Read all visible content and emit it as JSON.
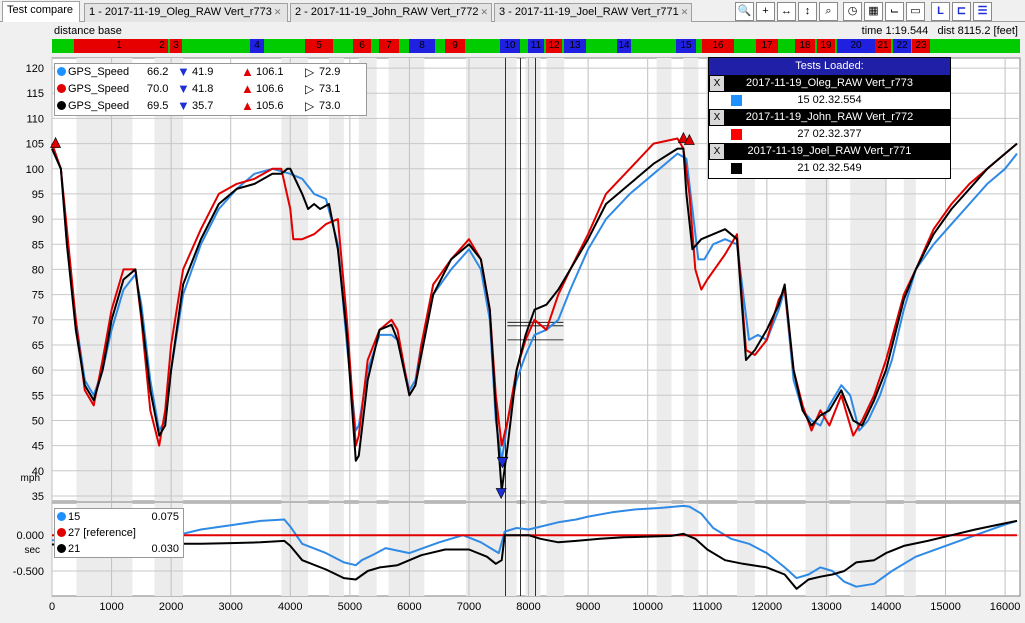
{
  "tabs": [
    {
      "label": "Test compare"
    },
    {
      "label": "1 - 2017-11-19_Oleg_RAW Vert_r773"
    },
    {
      "label": "2 - 2017-11-19_John_RAW Vert_r772"
    },
    {
      "label": "3 - 2017-11-19_Joel_RAW Vert_r771"
    }
  ],
  "toolbar": [
    "zoom-2d-icon",
    "zoom-in-icon",
    "zoom-x-icon",
    "zoom-y-icon",
    "zoom-reset-icon",
    "clock-icon",
    "grid-icon",
    "shoe-icon",
    "lap-icon",
    "l-axis-icon",
    "overlay-icon",
    "list-icon"
  ],
  "info": {
    "base": "distance base",
    "time": "time 1:19.544",
    "dist": "dist 8115.2 [feet]"
  },
  "segments": [
    {
      "label": "1",
      "color": "red"
    },
    {
      "label": "2",
      "color": "red"
    },
    {
      "label": "3",
      "color": "red"
    },
    {
      "label": "4",
      "color": "blue"
    },
    {
      "label": "5",
      "color": "red"
    },
    {
      "label": "6",
      "color": "red"
    },
    {
      "label": "7",
      "color": "red"
    },
    {
      "label": "8",
      "color": "blue"
    },
    {
      "label": "9",
      "color": "red"
    },
    {
      "label": "10",
      "color": "blue"
    },
    {
      "label": "11",
      "color": "blue"
    },
    {
      "label": "12",
      "color": "red"
    },
    {
      "label": "13",
      "color": "blue"
    },
    {
      "label": "14",
      "color": "blue"
    },
    {
      "label": "15",
      "color": "blue"
    },
    {
      "label": "16",
      "color": "red"
    },
    {
      "label": "17",
      "color": "red"
    },
    {
      "label": "18",
      "color": "red"
    },
    {
      "label": "19",
      "color": "red"
    },
    {
      "label": "20",
      "color": "blue"
    },
    {
      "label": "21",
      "color": "red"
    },
    {
      "label": "22",
      "color": "blue"
    },
    {
      "label": "23",
      "color": "red"
    }
  ],
  "speed_legend": [
    {
      "name": "GPS_Speed",
      "color": "#1e90ff",
      "current": "66.2",
      "min": "41.9",
      "max": "106.1",
      "avg": "72.9"
    },
    {
      "name": "GPS_Speed",
      "color": "#e00000",
      "current": "70.0",
      "min": "41.8",
      "max": "106.6",
      "avg": "73.1"
    },
    {
      "name": "GPS_Speed",
      "color": "#000000",
      "current": "69.5",
      "min": "35.7",
      "max": "105.6",
      "avg": "73.0"
    }
  ],
  "tests": {
    "title": "Tests Loaded:",
    "items": [
      {
        "name": "2017-11-19_Oleg_RAW Vert_r773",
        "lap": "15 02.32.554",
        "color": "#1e90ff"
      },
      {
        "name": "2017-11-19_John_RAW Vert_r772",
        "lap": "27 02.32.377",
        "color": "#ff0000"
      },
      {
        "name": "2017-11-19_Joel_RAW Vert_r771",
        "lap": "21 02.32.549",
        "color": "#000000"
      }
    ]
  },
  "delta_legend": [
    {
      "lap": "15",
      "value": "0.075",
      "color": "#1e90ff"
    },
    {
      "lap": "27 [reference]",
      "value": "",
      "color": "#e00000"
    },
    {
      "lap": "21",
      "value": "0.030",
      "color": "#000000"
    }
  ],
  "chart_data": [
    {
      "type": "line",
      "ylabel": "mph",
      "ylim": [
        34,
        122
      ],
      "xlim": [
        0,
        16250
      ],
      "yticks": [
        35,
        40,
        45,
        50,
        55,
        60,
        65,
        70,
        75,
        80,
        85,
        90,
        95,
        100,
        105,
        110,
        115,
        120
      ],
      "grid": true,
      "series": [
        {
          "color": "#2f8ae6",
          "x": [
            0,
            150,
            250,
            400,
            550,
            700,
            850,
            1000,
            1200,
            1400,
            1500,
            1650,
            1800,
            1900,
            2000,
            2200,
            2500,
            2800,
            3100,
            3400,
            3700,
            4000,
            4200,
            4400,
            4600,
            4800,
            4950,
            5100,
            5150,
            5300,
            5500,
            5700,
            5800,
            6000,
            6100,
            6200,
            6400,
            6700,
            7000,
            7200,
            7350,
            7450,
            7550,
            7650,
            7800,
            7950,
            8100,
            8300,
            8500,
            8700,
            9000,
            9300,
            9700,
            10100,
            10500,
            10650,
            10750,
            10850,
            10950,
            11100,
            11300,
            11500,
            11700,
            11850,
            12000,
            12200,
            12300,
            12450,
            12600,
            12750,
            12900,
            13050,
            13250,
            13400,
            13550,
            13700,
            13900,
            14100,
            14300,
            14500,
            14800,
            15100,
            15400,
            15700,
            16000,
            16200
          ],
          "y": [
            104,
            100,
            85,
            70,
            58,
            55,
            60,
            68,
            76,
            79,
            73,
            58,
            48,
            50,
            60,
            75,
            85,
            92,
            96,
            99,
            100,
            99,
            98,
            95,
            94,
            85,
            65,
            48,
            49,
            60,
            67,
            67,
            66,
            56,
            58,
            65,
            75,
            80,
            84,
            80,
            70,
            50,
            42,
            50,
            58,
            63,
            67,
            68,
            70,
            76,
            84,
            90,
            95,
            99,
            103,
            102,
            92,
            82,
            82,
            85,
            86,
            85,
            66,
            67,
            66,
            72,
            76,
            58,
            52,
            50,
            49,
            53,
            57,
            55,
            48,
            50,
            55,
            62,
            72,
            80,
            85,
            89,
            93,
            97,
            100,
            103
          ]
        },
        {
          "color": "#e00000",
          "x": [
            0,
            150,
            250,
            400,
            550,
            700,
            850,
            1000,
            1200,
            1400,
            1500,
            1650,
            1800,
            1900,
            2000,
            2200,
            2500,
            2800,
            3100,
            3400,
            3700,
            3850,
            4000,
            4050,
            4200,
            4400,
            4600,
            4800,
            4950,
            5100,
            5150,
            5300,
            5500,
            5700,
            5800,
            6000,
            6100,
            6200,
            6400,
            6700,
            7000,
            7200,
            7350,
            7450,
            7550,
            7650,
            7800,
            7950,
            8100,
            8300,
            8500,
            8700,
            9000,
            9300,
            9700,
            10100,
            10500,
            10600,
            10700,
            10800,
            10900,
            11000,
            11300,
            11500,
            11650,
            11800,
            12000,
            12200,
            12300,
            12450,
            12600,
            12750,
            12900,
            13050,
            13250,
            13450,
            13600,
            13800,
            14000,
            14300,
            14500,
            14800,
            15100,
            15400,
            15700,
            16000,
            16200
          ],
          "y": [
            105,
            100,
            88,
            70,
            56,
            53,
            62,
            72,
            80,
            80,
            70,
            52,
            45,
            52,
            65,
            80,
            88,
            95,
            97,
            98,
            100,
            100,
            92,
            86,
            86,
            87,
            89,
            90,
            70,
            45,
            47,
            62,
            68,
            70,
            68,
            55,
            57,
            65,
            77,
            82,
            86,
            82,
            72,
            55,
            45,
            50,
            60,
            66,
            70,
            68,
            75,
            80,
            87,
            95,
            100,
            105,
            106,
            104,
            95,
            80,
            76,
            78,
            83,
            87,
            64,
            63,
            66,
            74,
            76,
            60,
            53,
            48,
            52,
            49,
            55,
            47,
            50,
            55,
            62,
            75,
            80,
            88,
            93,
            97,
            100,
            103,
            105
          ]
        },
        {
          "color": "#000000",
          "x": [
            0,
            150,
            250,
            400,
            550,
            700,
            850,
            1000,
            1200,
            1400,
            1500,
            1650,
            1800,
            1900,
            2000,
            2200,
            2500,
            2800,
            3100,
            3400,
            3700,
            3850,
            3950,
            4000,
            4200,
            4300,
            4400,
            4500,
            4650,
            4800,
            4950,
            5100,
            5150,
            5300,
            5500,
            5700,
            5800,
            6000,
            6100,
            6200,
            6400,
            6700,
            7000,
            7200,
            7350,
            7450,
            7550,
            7650,
            7800,
            7950,
            8100,
            8300,
            8500,
            8700,
            9000,
            9300,
            9700,
            10100,
            10500,
            10600,
            10650,
            10750,
            10900,
            11100,
            11300,
            11500,
            11650,
            11800,
            12000,
            12200,
            12300,
            12450,
            12600,
            12750,
            12900,
            13050,
            13250,
            13450,
            13600,
            13800,
            14000,
            14300,
            14500,
            14800,
            15100,
            15400,
            15700,
            16000,
            16200
          ],
          "y": [
            104,
            100,
            85,
            68,
            57,
            54,
            60,
            70,
            78,
            80,
            71,
            56,
            47,
            49,
            60,
            77,
            86,
            93,
            96,
            97,
            99,
            99,
            100,
            100,
            95,
            92,
            93,
            92,
            93,
            84,
            67,
            42,
            43,
            58,
            68,
            69,
            66,
            55,
            57,
            63,
            75,
            82,
            85,
            82,
            72,
            52,
            36,
            45,
            60,
            67,
            72,
            73,
            76,
            80,
            86,
            93,
            97,
            101,
            104,
            104,
            95,
            84,
            86,
            87,
            88,
            86,
            62,
            64,
            68,
            73,
            77,
            60,
            52,
            49,
            51,
            52,
            56,
            50,
            49,
            54,
            60,
            74,
            80,
            87,
            92,
            96,
            100,
            103,
            105
          ]
        }
      ]
    },
    {
      "type": "line",
      "ylabel": "sec",
      "ylim": [
        -0.85,
        0.45
      ],
      "yticks": [
        -0.5,
        0.0
      ],
      "grid": true,
      "series": [
        {
          "color": "#2f8ae6",
          "x": [
            0,
            500,
            1000,
            1500,
            2000,
            2500,
            3000,
            3500,
            3900,
            4000,
            4200,
            4600,
            4900,
            5100,
            5200,
            5400,
            5600,
            6000,
            6500,
            6900,
            7200,
            7400,
            7500,
            7600,
            7800,
            8000,
            8200,
            8500,
            8800,
            9000,
            9400,
            9800,
            10200,
            10600,
            10700,
            10900,
            11100,
            11400,
            11700,
            12000,
            12300,
            12500,
            12700,
            12900,
            13100,
            13300,
            13500,
            13800,
            14100,
            14500,
            15000,
            15500,
            16000,
            16200
          ],
          "y": [
            -0.07,
            -0.07,
            -0.07,
            -0.06,
            -0.02,
            0.08,
            0.14,
            0.2,
            0.22,
            0.12,
            -0.12,
            -0.25,
            -0.38,
            -0.42,
            -0.35,
            -0.27,
            -0.18,
            -0.25,
            -0.1,
            0.0,
            -0.1,
            -0.2,
            -0.25,
            0.05,
            0.1,
            0.08,
            0.12,
            0.18,
            0.22,
            0.26,
            0.32,
            0.36,
            0.38,
            0.41,
            0.4,
            0.3,
            0.1,
            -0.05,
            -0.12,
            -0.25,
            -0.45,
            -0.6,
            -0.55,
            -0.45,
            -0.5,
            -0.65,
            -0.72,
            -0.68,
            -0.5,
            -0.3,
            -0.15,
            0.0,
            0.15,
            0.2
          ]
        },
        {
          "color": "#e00000",
          "x": [
            0,
            16200
          ],
          "y": [
            0.0,
            0.0
          ]
        },
        {
          "color": "#000000",
          "x": [
            0,
            500,
            1000,
            1500,
            2000,
            2500,
            3000,
            3500,
            3900,
            4000,
            4200,
            4600,
            4900,
            5100,
            5300,
            5500,
            5800,
            6200,
            6600,
            7000,
            7300,
            7450,
            7550,
            7600,
            7800,
            8000,
            8200,
            8500,
            8800,
            9200,
            9600,
            10000,
            10400,
            10600,
            10800,
            11000,
            11300,
            11600,
            12000,
            12300,
            12500,
            12700,
            12900,
            13100,
            13300,
            13500,
            13800,
            14000,
            14300,
            14700,
            15100,
            15500,
            15900,
            16200
          ],
          "y": [
            -0.13,
            -0.13,
            -0.12,
            -0.12,
            -0.12,
            -0.12,
            -0.11,
            -0.1,
            -0.08,
            -0.15,
            -0.35,
            -0.48,
            -0.6,
            -0.62,
            -0.5,
            -0.45,
            -0.42,
            -0.28,
            -0.2,
            -0.2,
            -0.3,
            -0.4,
            -0.35,
            0.0,
            0.0,
            0.0,
            -0.05,
            -0.1,
            -0.08,
            -0.05,
            -0.03,
            -0.02,
            -0.01,
            0.02,
            -0.05,
            -0.2,
            -0.35,
            -0.4,
            -0.45,
            -0.55,
            -0.75,
            -0.62,
            -0.58,
            -0.55,
            -0.5,
            -0.38,
            -0.35,
            -0.25,
            -0.15,
            -0.08,
            0.0,
            0.08,
            0.15,
            0.2
          ]
        }
      ]
    }
  ],
  "xticks": [
    0,
    1000,
    2000,
    3000,
    4000,
    5000,
    6000,
    7000,
    8000,
    9000,
    10000,
    11000,
    12000,
    13000,
    14000,
    15000,
    16000
  ],
  "shaded_bands": [
    [
      410,
      1350
    ],
    [
      1720,
      2200
    ],
    [
      3850,
      4300
    ],
    [
      4650,
      4900
    ],
    [
      5150,
      5450
    ],
    [
      5650,
      6250
    ],
    [
      6950,
      7800
    ],
    [
      7950,
      8200
    ],
    [
      8300,
      8600
    ],
    [
      10150,
      10400
    ],
    [
      10600,
      10850
    ],
    [
      11500,
      11800
    ],
    [
      12650,
      13050
    ],
    [
      13400,
      14000
    ],
    [
      14300,
      14500
    ]
  ],
  "cursor_x": 8115
}
